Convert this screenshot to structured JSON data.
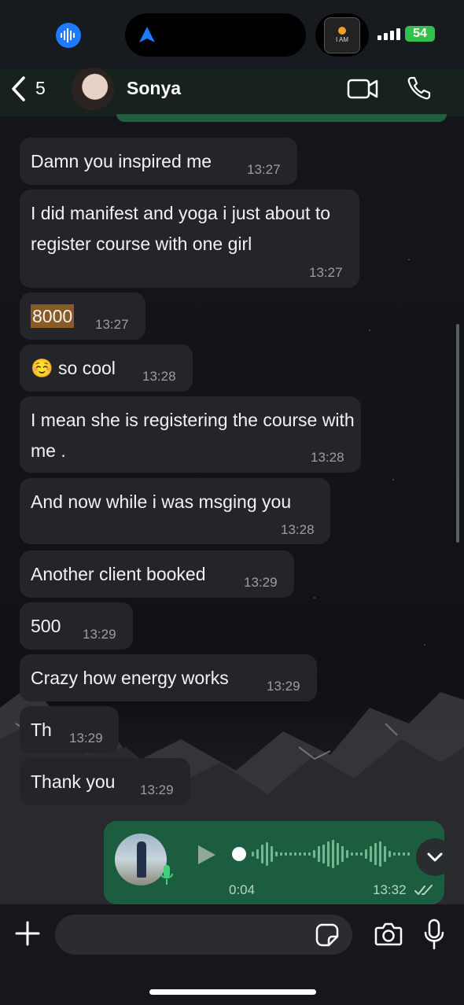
{
  "status_bar": {
    "battery": "54"
  },
  "island_badge": "I AM",
  "header": {
    "back_count": "5",
    "contact_name": "Sonya"
  },
  "messages": [
    {
      "text": "Damn you inspired me",
      "time": "13:27"
    },
    {
      "text": "I did manifest and yoga i just about to register course with one girl",
      "time": "13:27"
    },
    {
      "text": "8000",
      "time": "13:27"
    },
    {
      "emoji": "☺️",
      "text": "so cool",
      "time": "13:28"
    },
    {
      "text": "I mean she is registering the course with me .",
      "time": "13:28"
    },
    {
      "text": "And now while i was msging you",
      "time": "13:28"
    },
    {
      "text": "Another client booked",
      "time": "13:29"
    },
    {
      "text": "500",
      "time": "13:29"
    },
    {
      "text": "Crazy how energy works",
      "time": "13:29"
    },
    {
      "text": "Th",
      "time": "13:29"
    },
    {
      "text": "Thank you",
      "time": "13:29"
    }
  ],
  "voice_message": {
    "duration": "0:04",
    "time": "13:32",
    "progress": 0
  },
  "composer": {
    "placeholder": ""
  },
  "colors": {
    "incoming_bubble": "#23252a",
    "outgoing_bubble": "#1c5d3f",
    "header_bg": "#17221e",
    "accent_blue": "#1e7bff",
    "battery_green": "#33c04f",
    "highlight": "#8a5a22"
  },
  "icons": [
    "audio-wave-icon",
    "navigation-arrow-icon",
    "back-chevron-icon",
    "video-call-icon",
    "phone-call-icon",
    "play-icon",
    "mic-icon",
    "read-receipt-icon",
    "chevron-down-icon",
    "plus-icon",
    "sticker-icon",
    "camera-icon"
  ]
}
